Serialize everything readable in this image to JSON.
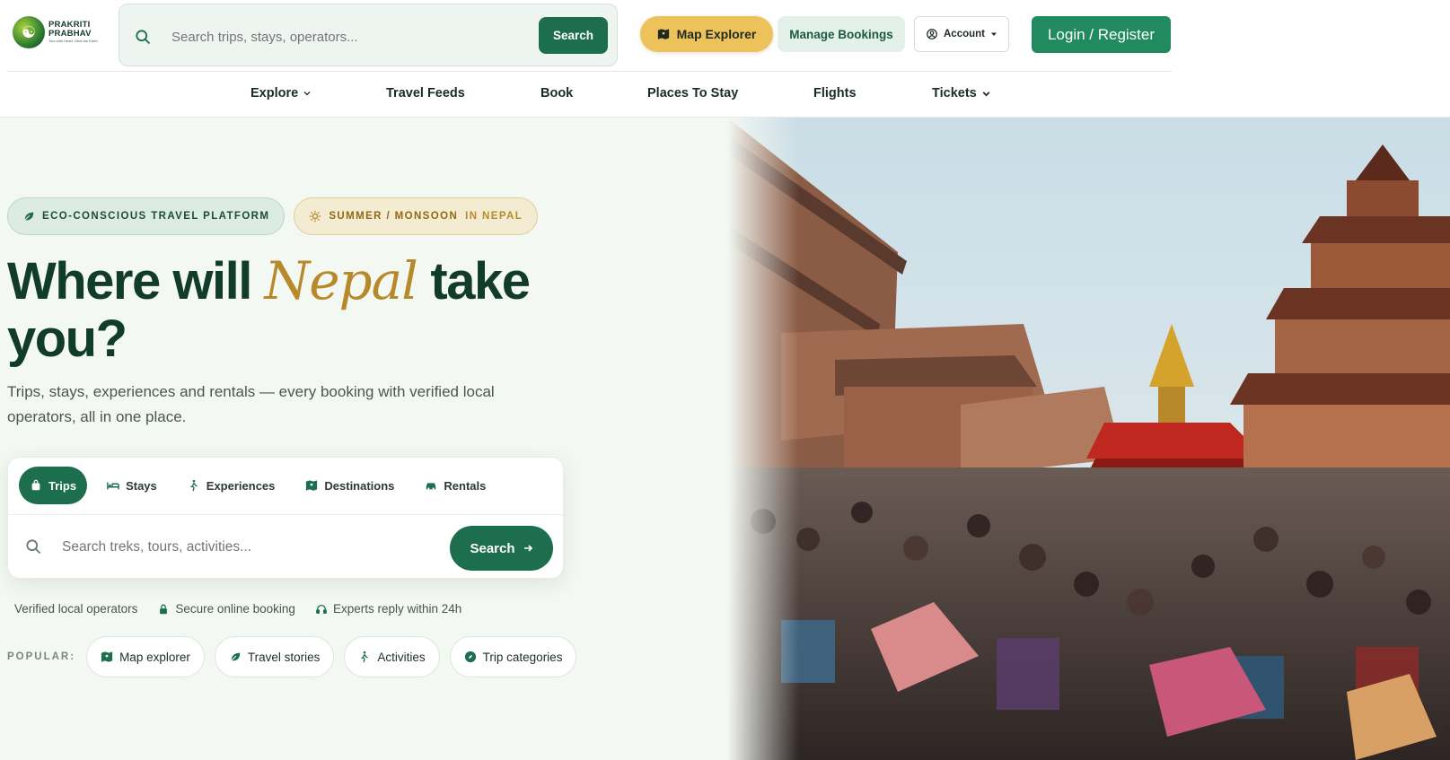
{
  "brand": {
    "name_line1": "PRAKRITI",
    "name_line2": "PRABHAV",
    "tagline": "Tour with Heart, Heal the Earth"
  },
  "top_search": {
    "placeholder": "Search trips, stays, operators...",
    "button_label": "Search"
  },
  "header_actions": {
    "map_explorer": "Map Explorer",
    "manage_bookings": "Manage Bookings",
    "account": "Account",
    "login_register": "Login / Register"
  },
  "nav": {
    "items": [
      {
        "label": "Explore",
        "has_dropdown": true
      },
      {
        "label": "Travel Feeds",
        "has_dropdown": false
      },
      {
        "label": "Book",
        "has_dropdown": false
      },
      {
        "label": "Places To Stay",
        "has_dropdown": false
      },
      {
        "label": "Flights",
        "has_dropdown": false
      },
      {
        "label": "Tickets",
        "has_dropdown": true
      }
    ]
  },
  "hero": {
    "badge_eco": "ECO-CONSCIOUS TRAVEL PLATFORM",
    "badge_season": "SUMMER / MONSOON",
    "badge_season_suffix": "IN NEPAL",
    "title_before": "Where will ",
    "title_accent": "Nepal",
    "title_after": " take you?",
    "subtitle": "Trips, stays, experiences and rentals — every booking with verified local operators, all in one place.",
    "search_tabs": [
      {
        "label": "Trips",
        "icon": "bag-icon",
        "active": true
      },
      {
        "label": "Stays",
        "icon": "bed-icon",
        "active": false
      },
      {
        "label": "Experiences",
        "icon": "hiker-icon",
        "active": false
      },
      {
        "label": "Destinations",
        "icon": "map-icon",
        "active": false
      },
      {
        "label": "Rentals",
        "icon": "car-icon",
        "active": false
      }
    ],
    "search_placeholder": "Search treks, tours, activities...",
    "search_button": "Search",
    "trust": [
      {
        "label": "Verified local operators",
        "icon": ""
      },
      {
        "label": "Secure online booking",
        "icon": "lock-icon"
      },
      {
        "label": "Experts reply within 24h",
        "icon": "headset-icon"
      }
    ],
    "popular_label": "POPULAR:",
    "popular": [
      {
        "label": "Map explorer",
        "icon": "map-icon"
      },
      {
        "label": "Travel stories",
        "icon": "feather-icon"
      },
      {
        "label": "Activities",
        "icon": "hiker-icon"
      },
      {
        "label": "Trip categories",
        "icon": "compass-icon"
      }
    ]
  },
  "colors": {
    "primary": "#1d6e4f",
    "accent_gold": "#b8892b",
    "map_button": "#edc25a",
    "hero_bg": "#f4f8f3"
  }
}
